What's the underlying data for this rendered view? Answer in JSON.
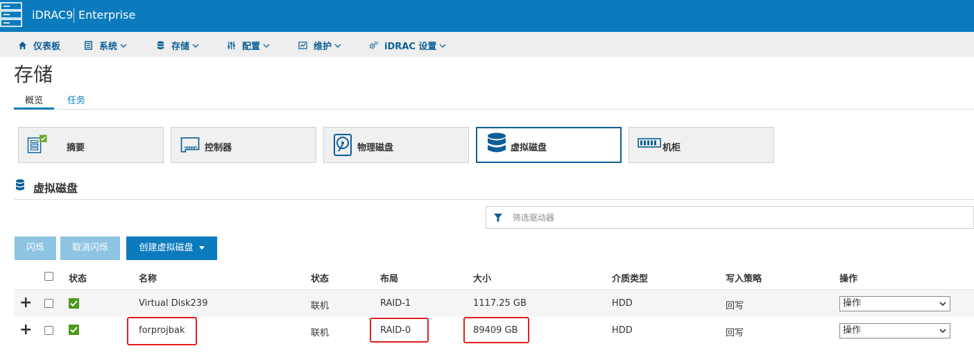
{
  "header": {
    "brand": "iDRAC9",
    "edition": "Enterprise",
    "logo_icon": "server-rack-icon",
    "color": "#0b7bbd"
  },
  "nav": [
    {
      "label": "仪表板",
      "icon": "home-icon"
    },
    {
      "label": "系统",
      "icon": "server-icon"
    },
    {
      "label": "存储",
      "icon": "database-icon"
    },
    {
      "label": "配置",
      "icon": "sliders-icon"
    },
    {
      "label": "维护",
      "icon": "chart-icon"
    },
    {
      "label": "iDRAC 设置",
      "icon": "gears-icon"
    }
  ],
  "page": {
    "title": "存储",
    "tabs": [
      {
        "label": "概览",
        "active": true
      },
      {
        "label": "任务",
        "active": false
      }
    ]
  },
  "cards": [
    {
      "label": "摘要",
      "icon": "summary-icon",
      "active": false
    },
    {
      "label": "控制器",
      "icon": "controller-icon",
      "active": false
    },
    {
      "label": "物理磁盘",
      "icon": "physical-disk-icon",
      "active": false
    },
    {
      "label": "虚拟磁盘",
      "icon": "virtual-disk-icon",
      "active": true
    },
    {
      "label": "机柜",
      "icon": "enclosure-icon",
      "active": false
    }
  ],
  "section": {
    "title": "虚拟磁盘",
    "icon": "database-icon"
  },
  "filter": {
    "placeholder": "筛选驱动器",
    "icon": "funnel-icon"
  },
  "buttons": {
    "blink": "闪烁",
    "unblink": "取消闪烁",
    "create": "创建虚拟磁盘"
  },
  "table": {
    "headers": {
      "status": "状态",
      "name": "名称",
      "state": "状态",
      "layout": "布局",
      "size": "大小",
      "media": "介质类型",
      "write_policy": "写入策略",
      "actions": "操作"
    },
    "rows": [
      {
        "name": "Virtual Disk239",
        "state": "联机",
        "layout": "RAID-1",
        "size": "1117.25 GB",
        "media": "HDD",
        "write_policy": "回写",
        "action": "操作",
        "status_ok": true
      },
      {
        "name": "forprojbak",
        "state": "联机",
        "layout": "RAID-0",
        "size": "89409 GB",
        "media": "HDD",
        "write_policy": "回写",
        "action": "操作",
        "status_ok": true
      }
    ]
  },
  "colors": {
    "accent": "#0b7bbd",
    "status_ok": "#4b9a1b",
    "highlight": "#e11d1d"
  }
}
